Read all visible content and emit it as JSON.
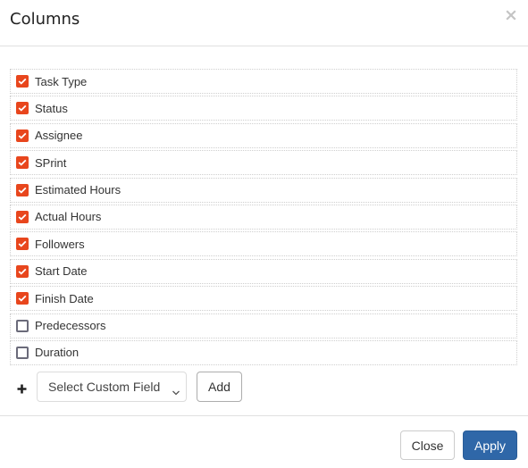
{
  "dialog": {
    "title": "Columns",
    "close_icon": "close-x-icon"
  },
  "columns": [
    {
      "label": "Task Type",
      "checked": true
    },
    {
      "label": "Status",
      "checked": true
    },
    {
      "label": "Assignee",
      "checked": true
    },
    {
      "label": "SPrint",
      "checked": true
    },
    {
      "label": "Estimated Hours",
      "checked": true
    },
    {
      "label": "Actual Hours",
      "checked": true
    },
    {
      "label": "Followers",
      "checked": true
    },
    {
      "label": "Start Date",
      "checked": true
    },
    {
      "label": "Finish Date",
      "checked": true
    },
    {
      "label": "Predecessors",
      "checked": false
    },
    {
      "label": "Duration",
      "checked": false
    }
  ],
  "custom_field": {
    "plus_icon": "plus-icon",
    "select_value": "Select Custom Field",
    "add_label": "Add"
  },
  "footer": {
    "close_label": "Close",
    "apply_label": "Apply"
  },
  "colors": {
    "checkbox_checked": "#e8461d",
    "primary": "#2f67a8"
  }
}
